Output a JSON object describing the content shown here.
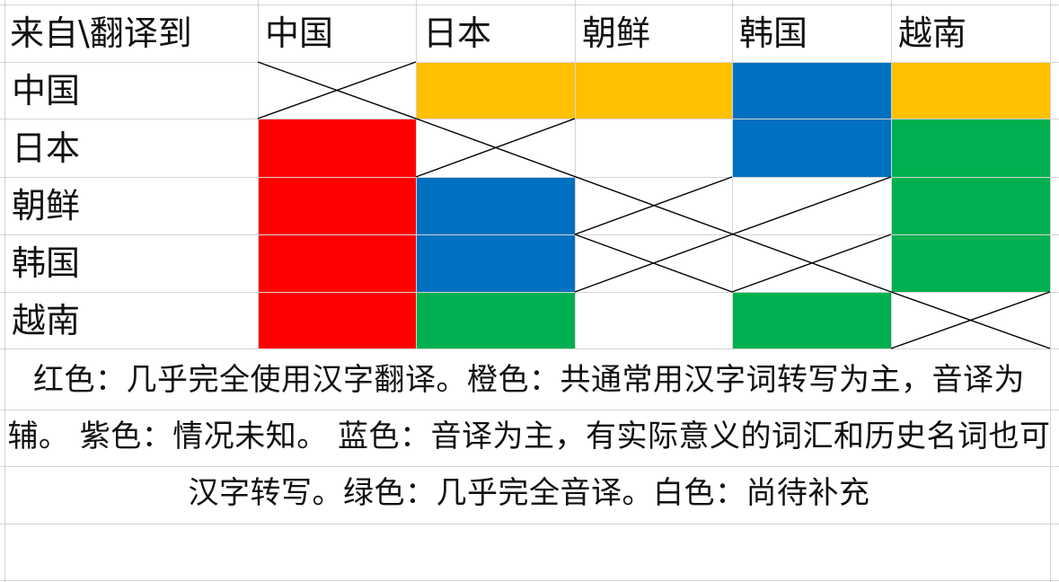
{
  "header": {
    "corner": "来自\\翻译到",
    "columns": [
      "中国",
      "日本",
      "朝鲜",
      "韩国",
      "越南"
    ]
  },
  "rows": [
    "中国",
    "日本",
    "朝鲜",
    "韩国",
    "越南"
  ],
  "colors": {
    "red": "#ff0000",
    "orange": "#ffc000",
    "blue": "#0070c0",
    "green": "#00b050",
    "white": "#ffffff",
    "grid": "#d4d4d4"
  },
  "legend": {
    "text": "红色：几乎完全使用汉字翻译。橙色：共通常用汉字词转写为主，音译为辅。 紫色：情况未知。 蓝色：音译为主，有实际意义的词汇和历史名词也可汉字转写。绿色：几乎完全音译。白色：尚待补充"
  }
}
